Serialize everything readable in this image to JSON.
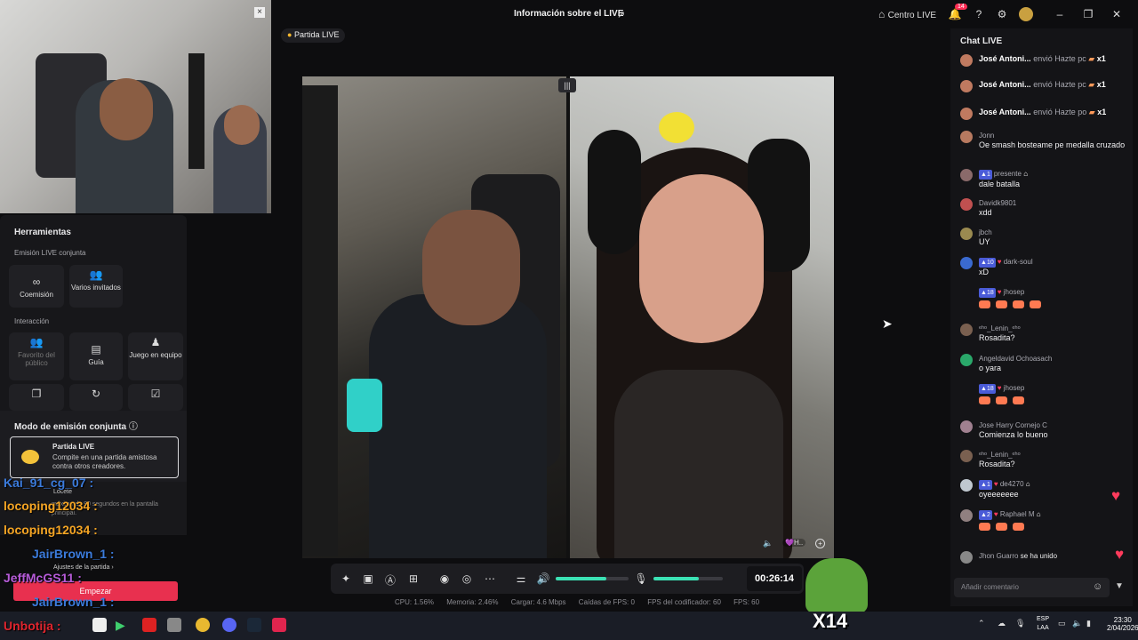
{
  "window": {
    "title": "Información sobre el LIVE",
    "centro": "Centro LIVE",
    "notif_count": "14"
  },
  "badge_partida": "Partida LIVE",
  "tools": {
    "heading": "Herramientas",
    "section1": "Emisión LIVE conjunta",
    "items1": [
      {
        "label": "Coemisión"
      },
      {
        "label": "Varios invitados"
      }
    ],
    "section2": "Interacción",
    "items2": [
      {
        "label": "Favorito del público"
      },
      {
        "label": "Guía"
      },
      {
        "label": "Juego en equipo"
      }
    ]
  },
  "modo": {
    "heading": "Modo de emisión conjunta",
    "partida_title": "Partida LIVE",
    "partida_desc": "Compite en una partida amistosa contra otros creadores.",
    "ajustes": "Ajustes de la partida",
    "empezar": "Empezar",
    "locete": "Locete",
    "bg_text": "máximo de 90 segundos en la pantalla principal."
  },
  "overlay": [
    {
      "name": "Kai_91_cg_07 :",
      "color": "#3b7bdc"
    },
    {
      "name": "locoping12034 :",
      "color": "#f5a524"
    },
    {
      "name": "locoping12034 :",
      "color": "#f5a524"
    },
    {
      "name": "JairBrown_1 :",
      "color": "#3b7bdc"
    },
    {
      "name": "JeffMcGS11 :",
      "color": "#b65bd8"
    },
    {
      "name": "JairBrown_1 :",
      "color": "#3b7bdc"
    },
    {
      "name": "Unbotija :",
      "color": "#e0252e"
    }
  ],
  "controls": {
    "timer": "00:26:14",
    "vol": 0.7,
    "mic": 0.65
  },
  "stats": [
    "CPU: 1.56%",
    "Memoria: 2.46%",
    "Cargar: 4.6 Mbps",
    "Caídas de FPS: 0",
    "FPS del codificador: 60",
    "FPS: 60"
  ],
  "chat": {
    "title": "Chat LIVE",
    "gifts": [
      {
        "user": "José Antoni...",
        "action": "envió Hazte pc",
        "count": "x1"
      },
      {
        "user": "José Antoni...",
        "action": "envió Hazte pc",
        "count": "x1"
      },
      {
        "user": "José Antoni...",
        "action": "envió Hazte po",
        "count": "x1"
      }
    ],
    "messages": [
      {
        "user": "Jonn",
        "text": "Oe smash bosteame pe medalla cruzado",
        "avatar": "#b87a60"
      },
      {
        "user": "presente",
        "level": "1",
        "text": "dale batalla",
        "avatar": "#8a6a6a"
      },
      {
        "user": "Davidk9801",
        "text": "xdd",
        "avatar": "#c05050"
      },
      {
        "user": "jbch",
        "text": "UY",
        "avatar": "#9a8a50"
      },
      {
        "user": "dark-soul",
        "level": "10",
        "text": "xD",
        "avatar": "#3a6ad0"
      },
      {
        "user": "jhosep",
        "level": "18",
        "text": "",
        "avatar": "#141417"
      },
      {
        "user": "ᵉʰᵒ_Lenin_ᵉʰᵒ",
        "text": "Rosadita?",
        "avatar": "#7a6050"
      },
      {
        "user": "Angeldavid Ochoasach",
        "text": "o yara",
        "avatar": "#2aa86a"
      },
      {
        "user": "jhosep",
        "level": "18",
        "text": "",
        "avatar": "#141417"
      },
      {
        "user": "Jose Harry Cornejo C",
        "text": "Comienza lo bueno",
        "avatar": "#a08090"
      },
      {
        "user": "ᵉʰᵒ_Lenin_ᵉʰᵒ",
        "text": "Rosadita?",
        "avatar": "#7a6050"
      },
      {
        "user": "de4270",
        "level": "1",
        "text": "oyeeeeeee",
        "avatar": "#c0c8d0"
      },
      {
        "user": "Raphael M",
        "level": "2",
        "text": "",
        "avatar": "#908080"
      }
    ],
    "joined": {
      "user": "Jhon Guarro",
      "text": "se ha unido"
    },
    "input_placeholder": "Añadir comentario"
  },
  "taskbar": {
    "time": "23:30",
    "date": "2/04/2026",
    "lang": "ESP",
    "lang2": "LAA"
  },
  "sticker_count": "X14"
}
